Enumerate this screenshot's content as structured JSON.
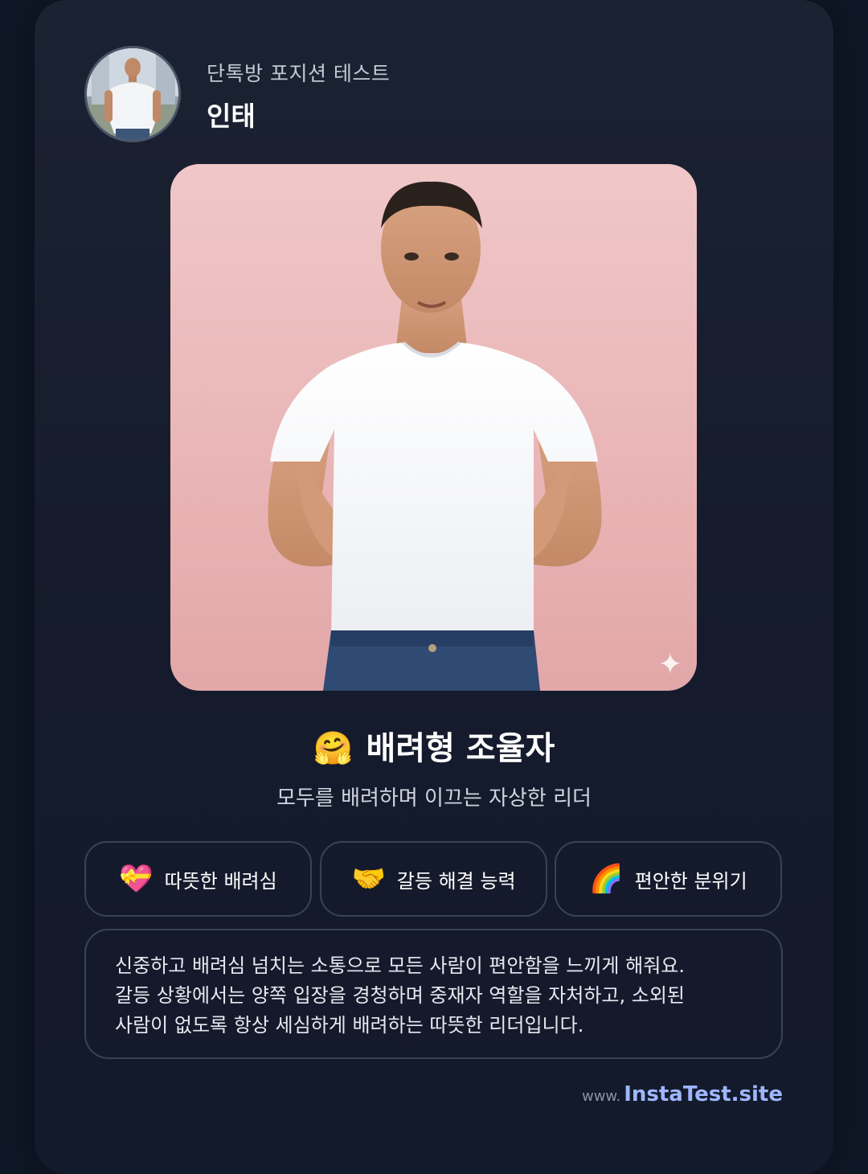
{
  "header": {
    "subtitle": "단톡방 포지션 테스트",
    "username": "인태",
    "avatar_icon": "avatar-photo"
  },
  "hero": {
    "image_icon": "man-open-arms-photo",
    "sparkle_icon": "sparkle-icon",
    "sparkle_glyph": "✦"
  },
  "result": {
    "emoji": "🤗",
    "title": "배려형 조율자",
    "description": "모두를 배려하며 이끄는 자상한 리더"
  },
  "traits": [
    {
      "emoji": "💝",
      "label": "따뜻한 배려심"
    },
    {
      "emoji": "🤝",
      "label": "갈등 해결 능력"
    },
    {
      "emoji": "🌈",
      "label": "편안한 분위기"
    }
  ],
  "summary": {
    "lines": [
      "신중하고 배려심 넘치는 소통으로 모든 사람이 편안함을 느끼게 해줘요.",
      "갈등 상황에서는 양쪽 입장을 경청하며 중재자 역할을 자처하고, 소외된",
      "사람이 없도록 항상 세심하게 배려하는 따뜻한 리더입니다."
    ]
  },
  "footer": {
    "prefix": "www.",
    "site": "InstaTest.site"
  },
  "colors": {
    "background": "#0f1625",
    "card": "#1b2232",
    "hero_bg": "#e9b4b5",
    "link": "#9fb6ff"
  }
}
